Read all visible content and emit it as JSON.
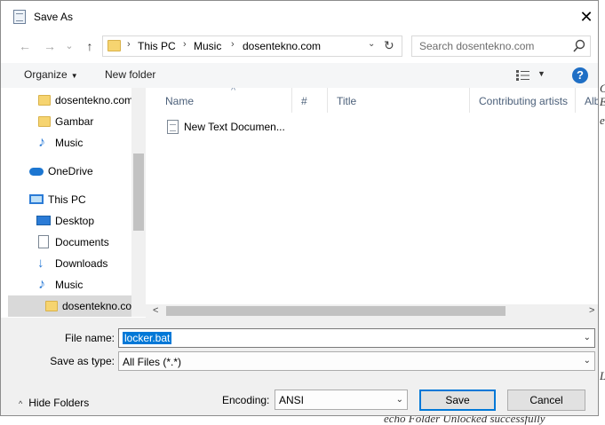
{
  "background_text": {
    "right_lines": [
      "C",
      "E",
      "e",
      "L"
    ],
    "bottom_line": "echo Folder Unlocked successfully"
  },
  "dialog": {
    "title": "Save As",
    "close_glyph": "✕"
  },
  "address_bar": {
    "back_glyph": "←",
    "forward_glyph": "→",
    "down_glyph": "⌄",
    "up_glyph": "↑",
    "crumbs": [
      "This PC",
      "Music",
      "dosentekno.com"
    ],
    "separator": "›",
    "dropdown_glyph": "⌄",
    "refresh_glyph": "↻"
  },
  "search": {
    "placeholder": "Search dosentekno.com"
  },
  "toolbar": {
    "organize_label": "Organize",
    "caret": "▼",
    "new_folder_label": "New folder",
    "help_label": "?"
  },
  "nav_pane": {
    "items": [
      {
        "label": "dosentekno.com",
        "icon": "folder-icon"
      },
      {
        "label": "Gambar",
        "icon": "folder-icon"
      },
      {
        "label": "Music",
        "icon": "music-icon"
      },
      {
        "label": "OneDrive",
        "icon": "cloud-icon"
      },
      {
        "label": "This PC",
        "icon": "pc-icon"
      },
      {
        "label": "Desktop",
        "icon": "desktop-icon"
      },
      {
        "label": "Documents",
        "icon": "documents-icon"
      },
      {
        "label": "Downloads",
        "icon": "download-icon"
      },
      {
        "label": "Music",
        "icon": "music-icon"
      },
      {
        "label": "dosentekno.com",
        "icon": "folder-icon",
        "selected": true
      }
    ]
  },
  "file_list": {
    "columns": [
      "Name",
      "#",
      "Title",
      "Contributing artists",
      "Albu"
    ],
    "sort_glyph": "^",
    "files": [
      {
        "name": "New Text Documen...",
        "icon": "text-file-icon"
      }
    ],
    "scroll_left_glyph": "<",
    "scroll_right_glyph": ">"
  },
  "form": {
    "file_name_label": "File name:",
    "file_name_value": "locker.bat",
    "save_as_type_label": "Save as type:",
    "save_as_type_value": "All Files  (*.*)",
    "dropdown_glyph": "⌄",
    "hide_folders_caret": "^",
    "hide_folders_label": "Hide Folders",
    "encoding_label": "Encoding:",
    "encoding_value": "ANSI",
    "save_label": "Save",
    "cancel_label": "Cancel"
  },
  "colors": {
    "accent": "#0078d7",
    "folder": "#f6d470",
    "icon_blue": "#2b7bd6",
    "help_blue": "#1f6fc5"
  }
}
